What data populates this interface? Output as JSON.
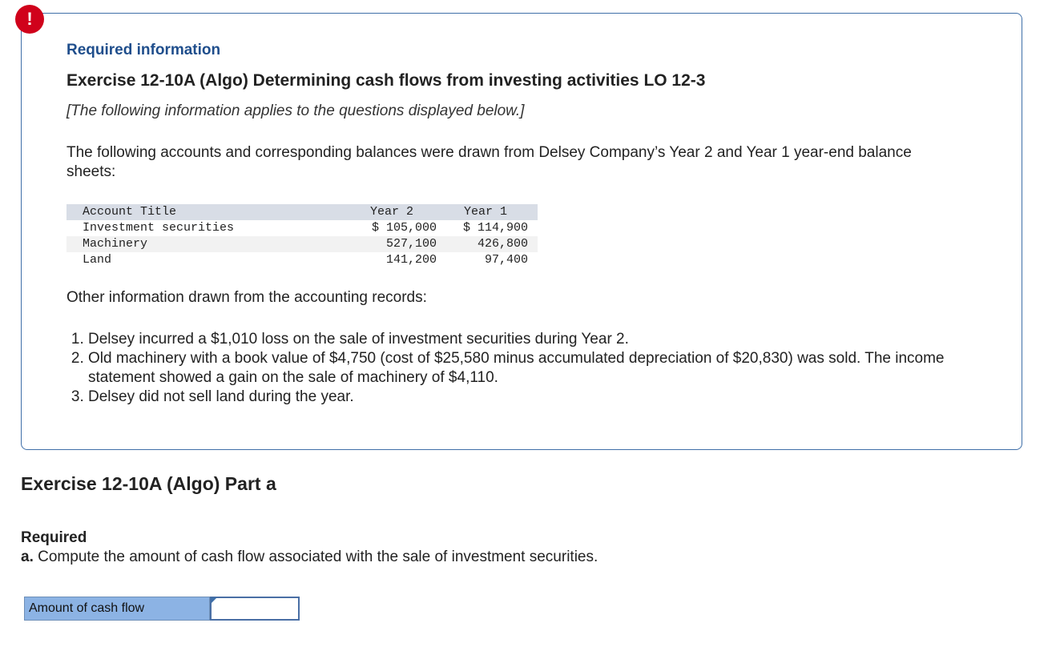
{
  "alert": {
    "symbol": "!"
  },
  "header": {
    "required_info": "Required information",
    "exercise_title": "Exercise 12-10A (Algo) Determining cash flows from investing activities LO 12-3",
    "applies_note": "[The following information applies to the questions displayed below.]"
  },
  "intro": "The following accounts and corresponding balances were drawn from Delsey Company’s Year 2 and Year 1 year-end balance sheets:",
  "table": {
    "headers": [
      "Account Title",
      "Year 2",
      "Year 1"
    ],
    "rows": [
      {
        "title": "Investment securities",
        "year2": "$ 105,000",
        "year1": "$ 114,900"
      },
      {
        "title": "Machinery",
        "year2": "527,100",
        "year1": "426,800"
      },
      {
        "title": "Land",
        "year2": "141,200",
        "year1": "97,400"
      }
    ]
  },
  "other_info": "Other information drawn from the accounting records:",
  "info_items": [
    "Delsey incurred a $1,010 loss on the sale of investment securities during Year 2.",
    "Old machinery with a book value of $4,750 (cost of $25,580 minus accumulated depreciation of $20,830) was sold. The income statement showed a gain on the sale of machinery of $4,110.",
    "Delsey did not sell land during the year."
  ],
  "part": {
    "title": "Exercise 12-10A (Algo) Part a",
    "required_label": "Required",
    "required_letter": "a.",
    "required_text": "Compute the amount of cash flow associated with the sale of investment securities."
  },
  "answer": {
    "label": "Amount of cash flow",
    "value": ""
  },
  "colors": {
    "alert": "#d0021b",
    "box_border": "#3f6fa8",
    "heading_blue": "#1f4e8c",
    "answer_label_bg": "#8cb3e4"
  }
}
